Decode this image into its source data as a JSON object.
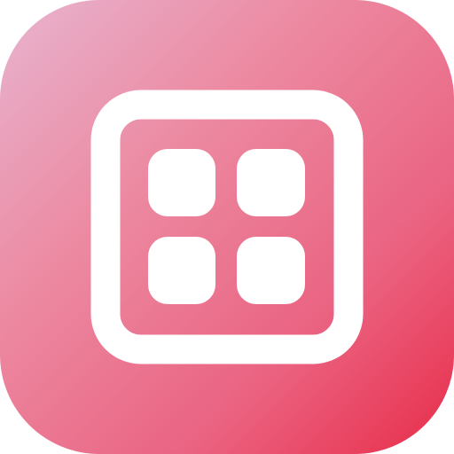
{
  "icon": {
    "name": "apps-grid-icon",
    "tile_count": 4,
    "colors": {
      "gradient_start": "#e8b4cf",
      "gradient_mid": "#ea6482",
      "gradient_end": "#e82d4a",
      "glyph": "#ffffff"
    }
  }
}
